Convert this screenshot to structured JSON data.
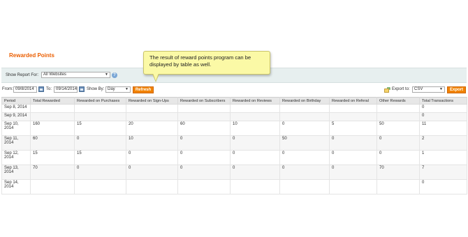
{
  "page_title": "Rewarded Points",
  "callout": {
    "text": "The result of reward points program can be displayed by table as well."
  },
  "report_for": {
    "label": "Show Report For:",
    "value": "All Websites"
  },
  "filters": {
    "from_label": "From:",
    "from_value": "09/8/2014",
    "to_label": "To:",
    "to_value": "09/14/2014",
    "show_by_label": "Show By:",
    "show_by_value": "Day",
    "refresh_label": "Refresh",
    "export_label": "Export to:",
    "export_format": "CSV",
    "export_button": "Export"
  },
  "table": {
    "columns": [
      "Period",
      "Total Rewarded",
      "Rewarded on Purchases",
      "Rewarded on Sign-Ups",
      "Rewarded on Subscribers",
      "Rewarded on Reviews",
      "Rewarded on Birthday",
      "Rewarded on Referal",
      "Other Rewards",
      "Total Transactions"
    ],
    "rows": [
      [
        "Sep 8, 2014",
        "",
        "",
        "",
        "",
        "",
        "",
        "",
        "",
        "0"
      ],
      [
        "Sep 9, 2014",
        "",
        "",
        "",
        "",
        "",
        "",
        "",
        "",
        "0"
      ],
      [
        "Sep 10, 2014",
        "160",
        "15",
        "20",
        "60",
        "10",
        "0",
        "5",
        "50",
        "11"
      ],
      [
        "Sep 11, 2014",
        "60",
        "0",
        "10",
        "0",
        "0",
        "50",
        "0",
        "0",
        "2"
      ],
      [
        "Sep 12, 2014",
        "15",
        "15",
        "0",
        "0",
        "0",
        "0",
        "0",
        "0",
        "1"
      ],
      [
        "Sep 13, 2014",
        "70",
        "0",
        "0",
        "0",
        "0",
        "0",
        "0",
        "70",
        "7"
      ],
      [
        "Sep 14, 2014",
        "",
        "",
        "",
        "",
        "",
        "",
        "",
        "",
        "0"
      ]
    ]
  },
  "colors": {
    "accent": "#eb5e00",
    "button": "#f18200",
    "callout_bg": "#fbf9a6"
  }
}
